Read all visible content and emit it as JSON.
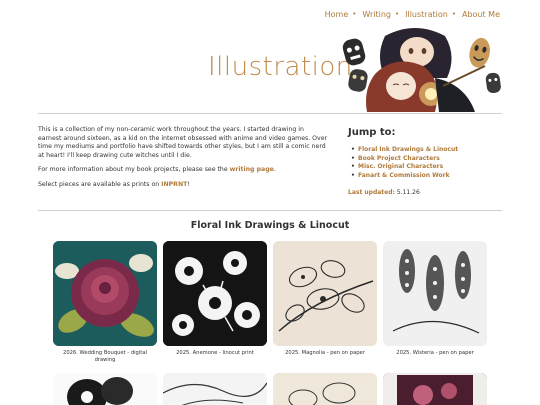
{
  "nav": {
    "items": [
      "Home",
      "Writing",
      "Illustration",
      "About Me"
    ],
    "separator": "•"
  },
  "header": {
    "title": "Illustration"
  },
  "intro": {
    "p1": "This is a collection of my non-ceramic work throughout the years. I started drawing in earnest around sixteen, as a kid on the internet obsessed with anime and video games. Over time my mediums and portfolio have shifted towards other styles, but I am still a comic nerd at heart! I'll keep drawing cute witches until I die.",
    "p2_before": "For more information about my book projects, please see the ",
    "p2_link": "writing page",
    "p2_after": ".",
    "p3_before": "Select pieces are available as prints on ",
    "p3_link": "INPRNT",
    "p3_after": "!"
  },
  "jump": {
    "heading": "Jump to:",
    "items": [
      "Floral Ink Drawings & Linocut",
      "Book Project Characters",
      "Misc. Original Characters",
      "Fanart & Commission Work"
    ],
    "updated_label": "Last updated:",
    "updated_value": "5.11.26"
  },
  "section": {
    "title": "Floral Ink Drawings & Linocut"
  },
  "gallery": {
    "row1": [
      {
        "caption": "2026. Wedding Bouquet - digital drawing"
      },
      {
        "caption": "2025. Anemone - linocut print"
      },
      {
        "caption": "2025. Magnolia - pen on paper"
      },
      {
        "caption": "2025. Wisteria - pen on paper"
      }
    ]
  },
  "colors": {
    "accent": "#b07a3a",
    "title": "#c08a4a",
    "text": "#333333",
    "rule": "#cfcfcf"
  }
}
